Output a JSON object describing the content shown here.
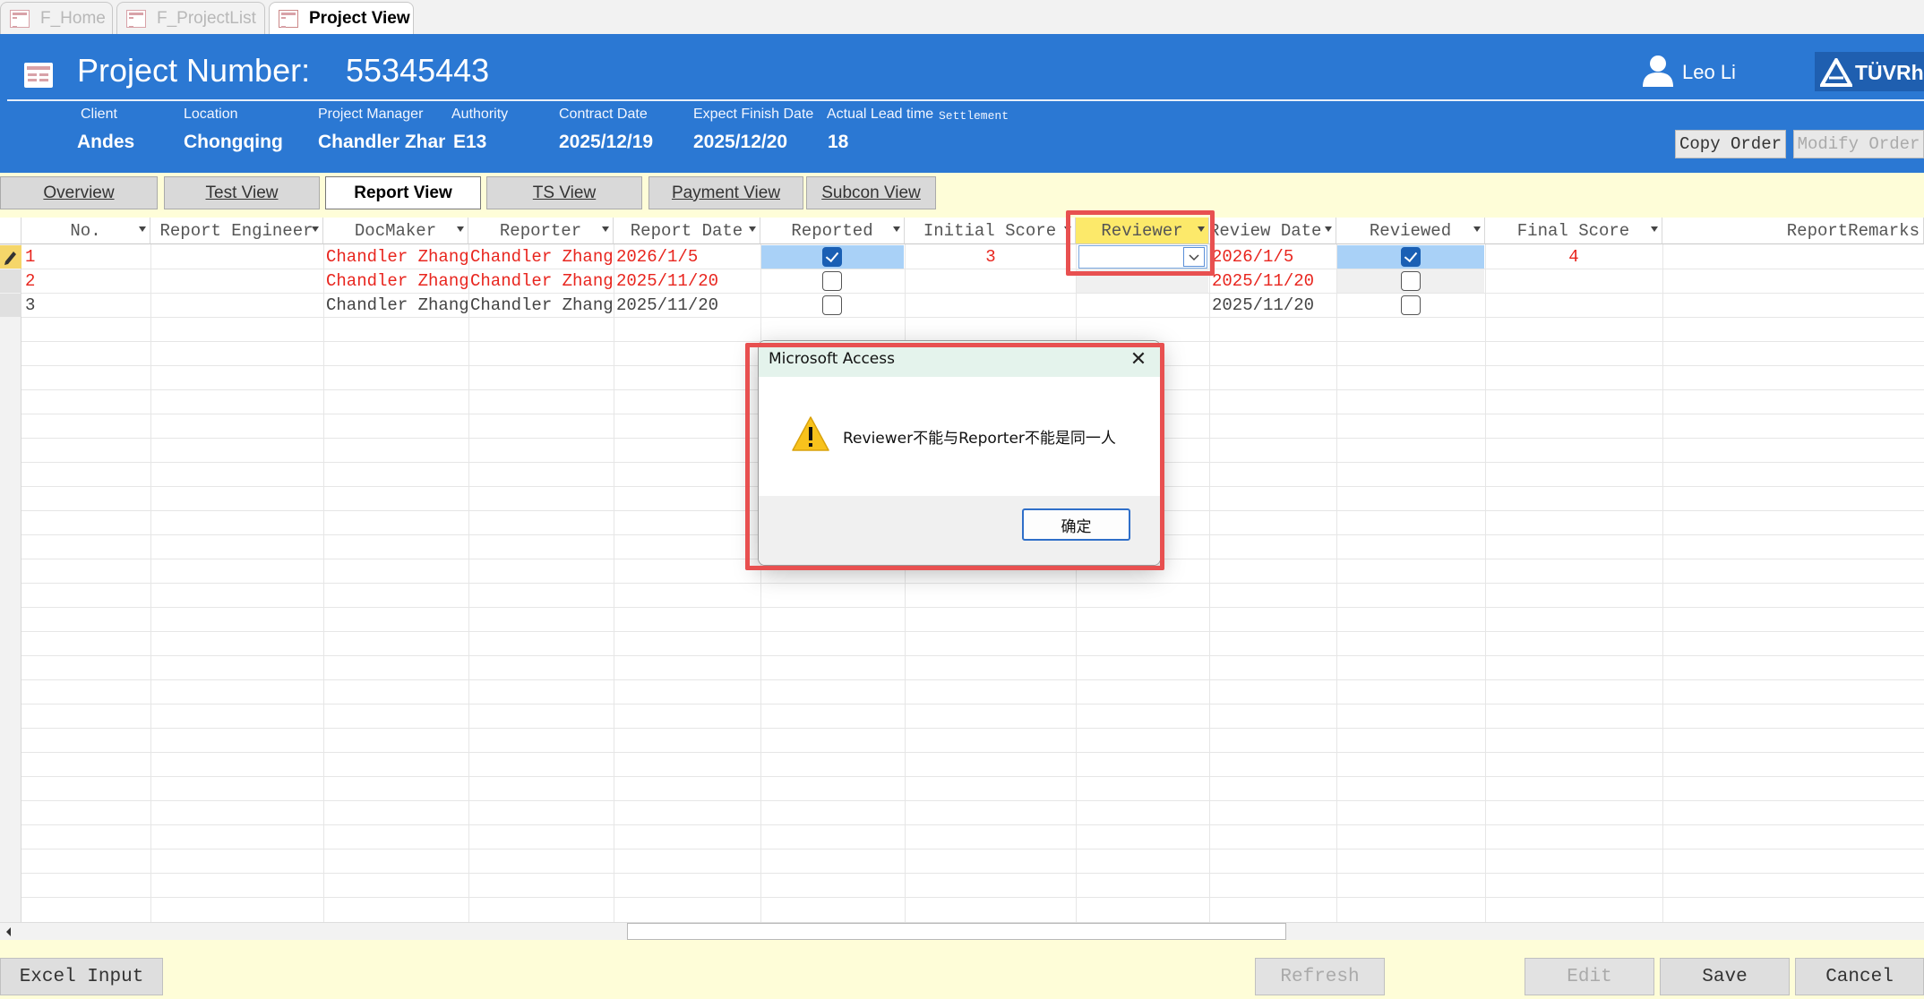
{
  "doc_tabs": [
    {
      "label": "F_Home"
    },
    {
      "label": "F_ProjectList"
    },
    {
      "label": "Project View"
    }
  ],
  "header": {
    "title_label": "Project Number:",
    "project_number": "55345443",
    "user_name": "Leo Li",
    "logo_text": "TÜVRh",
    "fields": [
      {
        "label": "Client",
        "value": "Andes"
      },
      {
        "label": "Location",
        "value": "Chongqing"
      },
      {
        "label": "Project Manager",
        "value": "Chandler Zhang"
      },
      {
        "label": "Authority",
        "value": "E13"
      },
      {
        "label": "Contract Date",
        "value": "2025/12/19"
      },
      {
        "label": "Expect Finish Date",
        "value": "2025/12/20"
      },
      {
        "label": "Actual Lead time",
        "value": "18"
      },
      {
        "label": "Settlement",
        "value": ""
      }
    ],
    "copy_order": "Copy Order",
    "modify_order": "Modify Order"
  },
  "section_tabs": [
    "Overview",
    "Test View",
    "Report View",
    "TS View",
    "Payment View",
    "Subcon View"
  ],
  "active_section": "Report View",
  "grid": {
    "columns": [
      "No.",
      "Report Engineer",
      "DocMaker",
      "Reporter",
      "Report Date",
      "Reported",
      "Initial Score",
      "Reviewer",
      "Review Date",
      "Reviewed",
      "Final Score",
      "ReportRemarks"
    ],
    "rows": [
      {
        "no": "1",
        "report_engineer": "",
        "docmaker": "Chandler Zhang",
        "reporter": "Chandler Zhang",
        "report_date": "2026/1/5",
        "reported": true,
        "initial_score": "3",
        "reviewer": "",
        "review_date": "2026/1/5",
        "reviewed": true,
        "final_score": "4",
        "remarks": "",
        "color": "red"
      },
      {
        "no": "2",
        "report_engineer": "",
        "docmaker": "Chandler Zhang",
        "reporter": "Chandler Zhang",
        "report_date": "2025/11/20",
        "reported": false,
        "initial_score": "",
        "reviewer": "",
        "review_date": "2025/11/20",
        "reviewed": false,
        "final_score": "",
        "remarks": "",
        "color": "red"
      },
      {
        "no": "3",
        "report_engineer": "",
        "docmaker": "Chandler Zhang",
        "reporter": "Chandler Zhang",
        "report_date": "2025/11/20",
        "reported": false,
        "initial_score": "",
        "reviewer": "",
        "review_date": "2025/11/20",
        "reviewed": false,
        "final_score": "",
        "remarks": "",
        "color": "gray"
      }
    ]
  },
  "dialog": {
    "title": "Microsoft Access",
    "message": "Reviewer不能与Reporter不能是同一人",
    "ok": "确定",
    "close": "✕"
  },
  "footer": {
    "excel_input": "Excel Input",
    "refresh": "Refresh",
    "edit": "Edit",
    "save": "Save",
    "cancel": "Cancel"
  },
  "colors": {
    "header_blue": "#2b78d3",
    "band_yellow": "#fefdd8",
    "row_red": "#e8251e",
    "highlight": "#e85050",
    "reviewer_header": "#fce96a"
  }
}
